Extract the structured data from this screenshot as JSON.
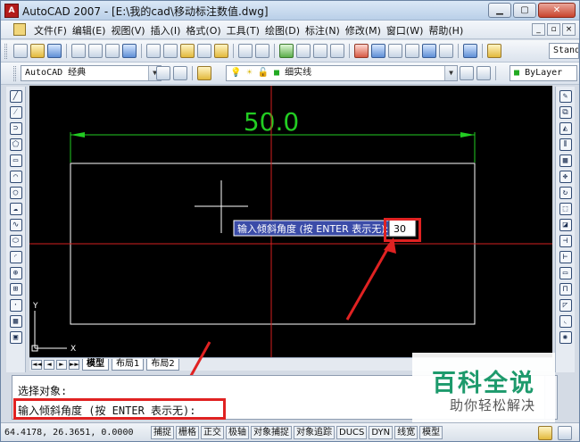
{
  "window": {
    "title": "AutoCAD 2007 - [E:\\我的cad\\移动标注数值.dwg]",
    "minimize": "▁",
    "maximize": "▢",
    "close": "✕"
  },
  "menubar": {
    "items": [
      "文件(F)",
      "编辑(E)",
      "视图(V)",
      "插入(I)",
      "格式(O)",
      "工具(T)",
      "绘图(D)",
      "标注(N)",
      "修改(M)",
      "窗口(W)",
      "帮助(H)"
    ],
    "mdi_min": "_",
    "mdi_restore": "▫",
    "mdi_close": "×"
  },
  "toolbar1": {
    "style_dropdown": "Stand"
  },
  "toolbar2": {
    "workspace": "AutoCAD 经典",
    "layer": "细实线",
    "linetype": "ByLayer"
  },
  "canvas": {
    "dimension_text": "50.0",
    "tooltip_prompt": "输入倾斜角度 (按 ENTER 表示无):",
    "tooltip_value": "30",
    "ucs_x": "X",
    "ucs_y": "Y",
    "colors": {
      "background": "#000000",
      "dimension": "#22cc22",
      "geometry": "#ffffff",
      "crosshair_center": "#d42020",
      "tooltip_bg": "#3b4ca8"
    }
  },
  "tabs": {
    "nav": [
      "◄◄",
      "◄",
      "►",
      "►►"
    ],
    "items": [
      "模型",
      "布局1",
      "布局2"
    ],
    "active": "模型"
  },
  "command": {
    "line1": "选择对象:",
    "line2": "输入倾斜角度 (按 ENTER 表示无):"
  },
  "status": {
    "coords": "64.4178,  26.3651, 0.0000",
    "buttons": [
      "捕捉",
      "栅格",
      "正交",
      "极轴",
      "对象捕捉",
      "对象追踪",
      "DUCS",
      "DYN",
      "线宽",
      "模型"
    ]
  },
  "watermark": {
    "title": "百科全说",
    "subtitle": "助你轻松解决"
  }
}
